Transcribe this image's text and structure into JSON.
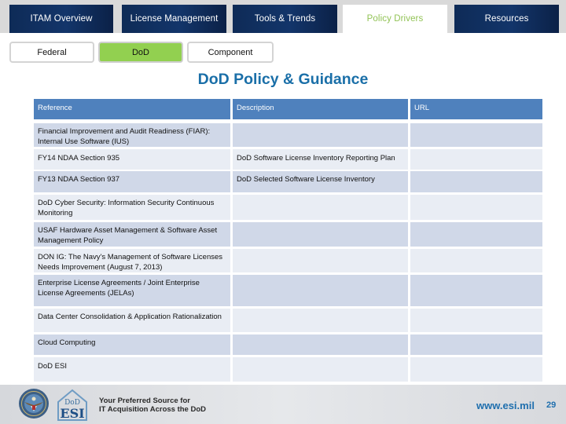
{
  "top_tabs": [
    {
      "label": "ITAM Overview",
      "active": false
    },
    {
      "label": "License Management",
      "active": false
    },
    {
      "label": "Tools & Trends",
      "active": false
    },
    {
      "label": "Policy Drivers",
      "active": true
    },
    {
      "label": "Resources",
      "active": false
    }
  ],
  "sub_tabs": [
    {
      "label": "Federal",
      "active": false
    },
    {
      "label": "DoD",
      "active": true
    },
    {
      "label": "Component",
      "active": false
    }
  ],
  "title": "DoD Policy & Guidance",
  "table": {
    "headers": [
      "Reference",
      "Description",
      "URL"
    ],
    "rows": [
      {
        "reference": "Financial Improvement and Audit Readiness (FIAR): Internal Use Software (IUS)",
        "description": "",
        "url": ""
      },
      {
        "reference": "FY14 NDAA Section 935",
        "description": "DoD Software License Inventory Reporting Plan",
        "url": ""
      },
      {
        "reference": "FY13 NDAA Section 937",
        "description": "DoD Selected Software License Inventory",
        "url": ""
      },
      {
        "reference": "DoD Cyber Security: Information Security Continuous Monitoring",
        "description": "",
        "url": ""
      },
      {
        "reference": "USAF Hardware Asset Management & Software Asset Management Policy",
        "description": "",
        "url": ""
      },
      {
        "reference": "DON IG: The Navy's Management of Software Licenses Needs Improvement (August 7, 2013)",
        "description": "",
        "url": ""
      },
      {
        "reference": "Enterprise License Agreements / Joint Enterprise License Agreements (JELAs)",
        "description": "",
        "url": ""
      },
      {
        "reference": "Data Center Consolidation & Application Rationalization",
        "description": "",
        "url": ""
      },
      {
        "reference": "Cloud Computing",
        "description": "",
        "url": ""
      },
      {
        "reference": "DoD ESI",
        "description": "",
        "url": ""
      }
    ]
  },
  "footer": {
    "seal_icon": "dod-seal-icon",
    "logo_top": "DoD",
    "logo_bottom": "ESI",
    "tagline_line1": "Your Preferred Source for",
    "tagline_line2": "IT Acquisition Across the DoD",
    "url": "www.esi.mil",
    "page_number": "29"
  },
  "colors": {
    "tab_bg": "#13356a",
    "active_tab_text": "#92c356",
    "active_subtab_bg": "#92d050",
    "title": "#1a6fa8",
    "table_header": "#4f81bd",
    "row_odd": "#d0d8e8",
    "row_even": "#e9edf4",
    "footer_link": "#1f6fae"
  }
}
